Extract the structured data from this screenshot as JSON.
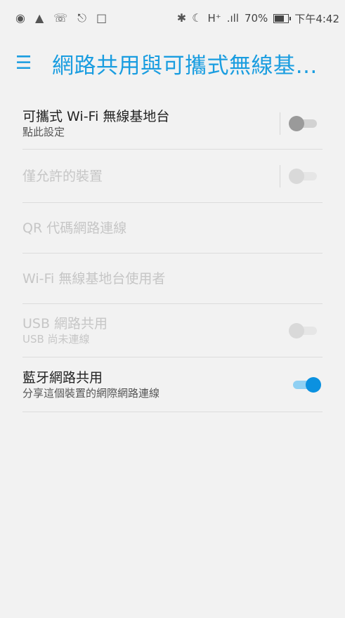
{
  "status_bar": {
    "left_icons": [
      "wifi-hotspot-icon",
      "image-icon",
      "call-icon",
      "paint-roller-icon",
      "sd-card-icon"
    ],
    "bluetooth_icon": "bluetooth-icon",
    "moon_icon": "moon-alarm-icon",
    "network_type": "H⁺",
    "signal": ".ıll",
    "battery_percent": "70%",
    "battery_level": 0.7,
    "time": "下午4:42"
  },
  "header": {
    "menu_glyph": "☰",
    "title": "網路共用與可攜式無線基地台"
  },
  "settings": [
    {
      "title": "可攜式 Wi-Fi 無線基地台",
      "subtitle": "點此設定"
    },
    {
      "title": "僅允許的裝置"
    },
    {
      "title": "QR 代碼網路連線"
    },
    {
      "title": "Wi-Fi 無線基地台使用者"
    },
    {
      "title": "USB 網路共用",
      "subtitle": "USB 尚未連線"
    },
    {
      "title": "藍牙網路共用",
      "subtitle": "分享這個裝置的網際網路連線"
    }
  ],
  "colors": {
    "accent": "#1a9de0",
    "toggle_on": "#0b91e0",
    "disabled_text": "#c6c6c6"
  }
}
